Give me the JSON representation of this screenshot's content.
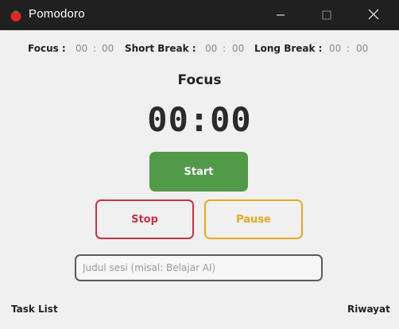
{
  "window": {
    "title": "Pomodoro",
    "icon": "tomato-icon",
    "controls": [
      "minimize-icon",
      "maximize-icon",
      "close-icon"
    ]
  },
  "durations": {
    "focus_label": "Focus :",
    "focus_min": "00",
    "focus_sep": ":",
    "focus_sec": "00",
    "short_label": "Short Break :",
    "short_min": "00",
    "short_sep": ":",
    "short_sec": "00",
    "long_label": "Long Break :",
    "long_min": "00",
    "long_sep": ":",
    "long_sec": "00"
  },
  "timer": {
    "mode": "Focus",
    "display": "00:00"
  },
  "buttons": {
    "start": "Start",
    "stop": "Stop",
    "pause": "Pause"
  },
  "session": {
    "placeholder": "Judul sesi (misal: Belajar AI)",
    "value": ""
  },
  "footer": {
    "task_list": "Task List",
    "history": "Riwayat"
  },
  "colors": {
    "start": "#529a4a",
    "stop": "#c43446",
    "pause": "#e7a822",
    "titlebar": "#202020"
  }
}
